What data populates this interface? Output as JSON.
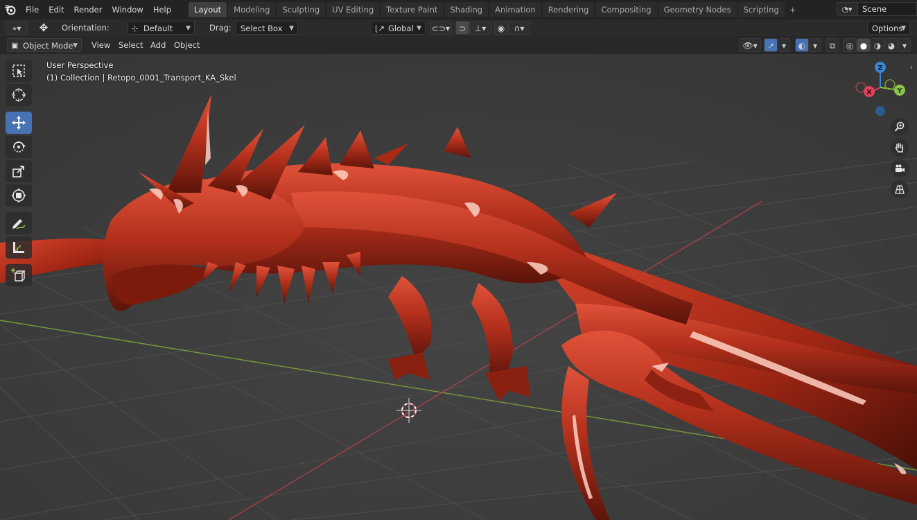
{
  "topbar": {
    "logo": "blender-icon",
    "menu": [
      "File",
      "Edit",
      "Render",
      "Window",
      "Help"
    ],
    "workspaces": [
      "Layout",
      "Modeling",
      "Sculpting",
      "UV Editing",
      "Texture Paint",
      "Shading",
      "Animation",
      "Rendering",
      "Compositing",
      "Geometry Nodes",
      "Scripting"
    ],
    "active_workspace": "Layout",
    "add_workspace": "+",
    "scene_name": "Scene"
  },
  "tool_header": {
    "orientation_label": "Orientation:",
    "orientation_value": "Default",
    "drag_label": "Drag:",
    "drag_value": "Select Box",
    "transform_orientation": "Global",
    "options_label": "Options"
  },
  "viewport_header": {
    "mode": "Object Mode",
    "menus": [
      "View",
      "Select",
      "Add",
      "Object"
    ]
  },
  "viewport": {
    "perspective": "User Perspective",
    "collection": "(1) Collection | Retopo_0001_Transport_KA_Skel"
  },
  "gizmo": {
    "x": "X",
    "y": "Y",
    "z": "Z"
  },
  "toolbar": {
    "tools": [
      "select-box",
      "cursor",
      "move",
      "rotate",
      "scale",
      "transform",
      "annotate",
      "measure",
      "add-cube"
    ],
    "active": "move"
  },
  "colors": {
    "accent": "#4772b3",
    "model": "#b8351f",
    "axis_x": "#e0415a",
    "axis_y": "#8bc34a",
    "axis_z": "#3a86d9"
  }
}
